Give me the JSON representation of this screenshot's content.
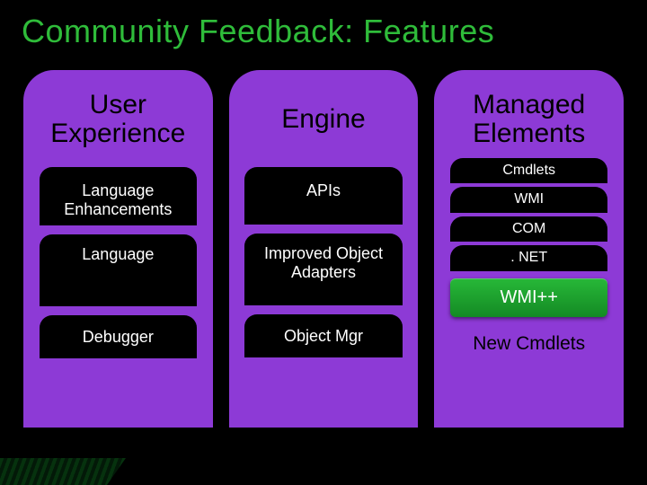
{
  "title": "Community Feedback:  Features",
  "columns": [
    {
      "title": "User Experience",
      "items": [
        {
          "label": "Language Enhancements",
          "style": "tall"
        },
        {
          "label": "Language",
          "style": "taller"
        },
        {
          "label": "Debugger",
          "style": "mid"
        }
      ]
    },
    {
      "title": "Engine",
      "items": [
        {
          "label": "APIs",
          "style": "tall"
        },
        {
          "label": "Improved Object Adapters",
          "style": "taller"
        },
        {
          "label": "Object Mgr",
          "style": "mid"
        }
      ]
    },
    {
      "title": "Managed Elements",
      "stack": [
        {
          "label": "Cmdlets"
        },
        {
          "label": "WMI"
        },
        {
          "label": "COM"
        },
        {
          "label": ". NET"
        }
      ],
      "highlight": "WMI++",
      "plain": "New Cmdlets"
    }
  ]
}
